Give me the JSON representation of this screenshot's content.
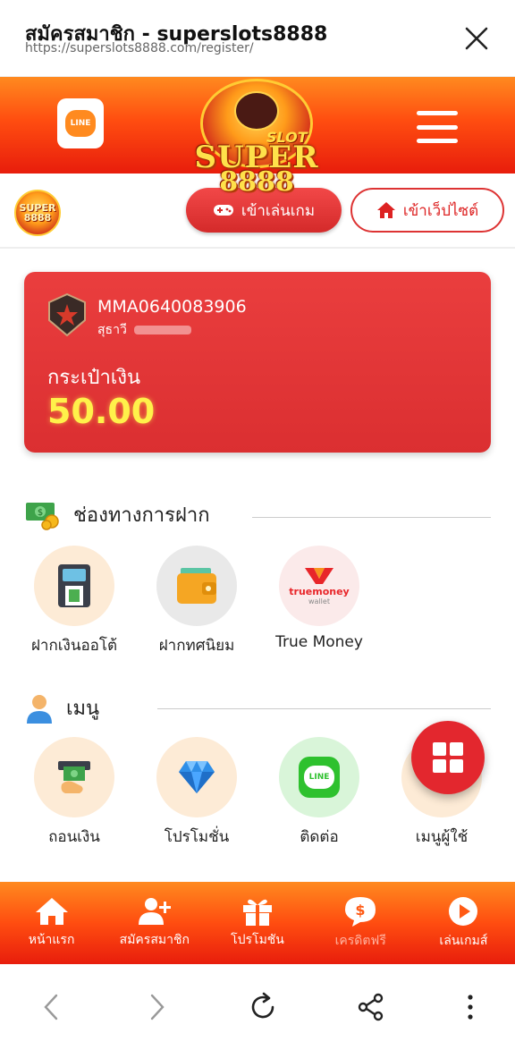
{
  "browser": {
    "title": "สมัครสมาชิก - superslots8888",
    "url": "https://superslots8888.com/register/"
  },
  "header": {
    "line_label": "LINE",
    "logo_line1": "SUPER",
    "logo_line2": "8888",
    "logo_slot": "SLOT"
  },
  "subheader": {
    "small_logo_line1": "SUPER",
    "small_logo_line2": "8888",
    "game_button": "เข้าเล่นเกม",
    "web_button": "เข้าเว็ปไซต์"
  },
  "account_card": {
    "username": "MMA0640083906",
    "display_name": "สุธาวี",
    "wallet_label": "กระเป๋าเงิน",
    "balance": "50.00"
  },
  "deposit_section": {
    "title": "ช่องทางการฝาก",
    "items": [
      {
        "label": "ฝากเงินออโต้",
        "icon": "atm-icon"
      },
      {
        "label": "ฝากทศนิยม",
        "icon": "wallet-icon"
      },
      {
        "label": "True Money",
        "icon": "truemoney-logo"
      }
    ],
    "truemoney_logo_text1": "truemoney",
    "truemoney_logo_text2": "wallet"
  },
  "menu_section": {
    "title": "เมนู",
    "items": [
      {
        "label": "ถอนเงิน",
        "icon": "cash-withdraw-icon"
      },
      {
        "label": "โปรโมชั่น",
        "icon": "diamond-icon"
      },
      {
        "label": "ติดต่อ",
        "icon": "line-icon"
      },
      {
        "label": "เมนูผู้ใช้",
        "icon": "grid-menu-icon"
      }
    ],
    "line_icon_text": "LINE"
  },
  "bottom_nav": [
    {
      "label": "หน้าแรก",
      "icon": "home-icon"
    },
    {
      "label": "สมัครสมาชิก",
      "icon": "add-user-icon"
    },
    {
      "label": "โปรโมชัน",
      "icon": "gift-icon"
    },
    {
      "label": "เครดิตฟรี",
      "icon": "coin-bubble-icon"
    },
    {
      "label": "เล่นเกมส์",
      "icon": "play-icon"
    }
  ],
  "colors": {
    "brand_red": "#e3272e",
    "header_orange": "#ff6a15",
    "balance_yellow": "#fff14a"
  }
}
